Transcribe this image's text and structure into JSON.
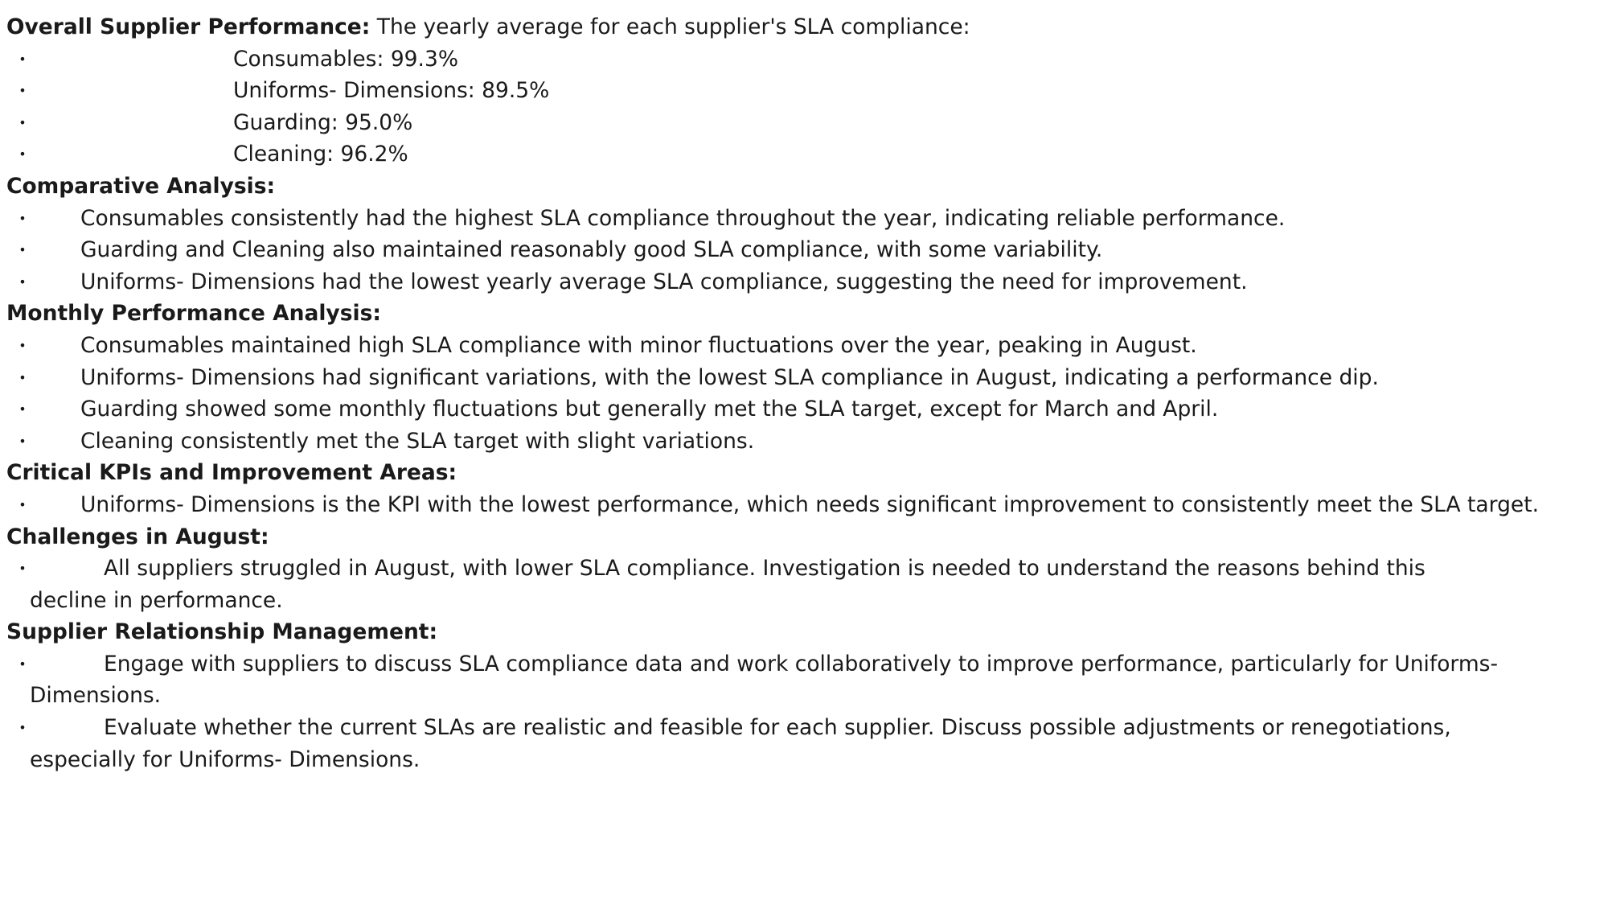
{
  "overall": {
    "heading": "Overall Supplier Performance:",
    "intro": " The yearly average for each supplier's SLA compliance:",
    "items": [
      "Consumables: 99.3%",
      "Uniforms- Dimensions: 89.5%",
      "Guarding: 95.0%",
      "Cleaning: 96.2%"
    ]
  },
  "comparative": {
    "heading": "Comparative Analysis:",
    "items": [
      "Consumables consistently had the highest SLA compliance throughout the year, indicating reliable performance.",
      "Guarding and Cleaning also maintained reasonably good SLA compliance, with some variability.",
      "Uniforms- Dimensions had the lowest yearly average SLA compliance, suggesting the need for improvement."
    ]
  },
  "monthly": {
    "heading": "Monthly Performance Analysis:",
    "items": [
      "Consumables maintained high SLA compliance with minor fluctuations over the year, peaking in August.",
      "Uniforms- Dimensions had significant variations, with the lowest SLA compliance in August, indicating a performance dip.",
      "Guarding showed some monthly fluctuations but generally met the SLA target, except for March and April.",
      "Cleaning consistently met the SLA target with slight variations."
    ]
  },
  "critical": {
    "heading": "Critical KPIs and Improvement Areas:",
    "items": [
      "Uniforms- Dimensions is the KPI with the lowest performance, which needs significant improvement to consistently meet the SLA target."
    ]
  },
  "august": {
    "heading": "Challenges in August:",
    "items": [
      "All suppliers struggled in August, with lower SLA compliance. Investigation is needed to understand the reasons behind this decline in performance."
    ]
  },
  "relationship": {
    "heading": "Supplier Relationship Management:",
    "items": [
      "Engage with suppliers to discuss SLA compliance data and work collaboratively to improve performance, particularly for Uniforms- Dimensions.",
      "Evaluate whether the current SLAs are realistic and feasible for each supplier. Discuss possible adjustments or renegotiations, especially for Uniforms- Dimensions."
    ]
  }
}
